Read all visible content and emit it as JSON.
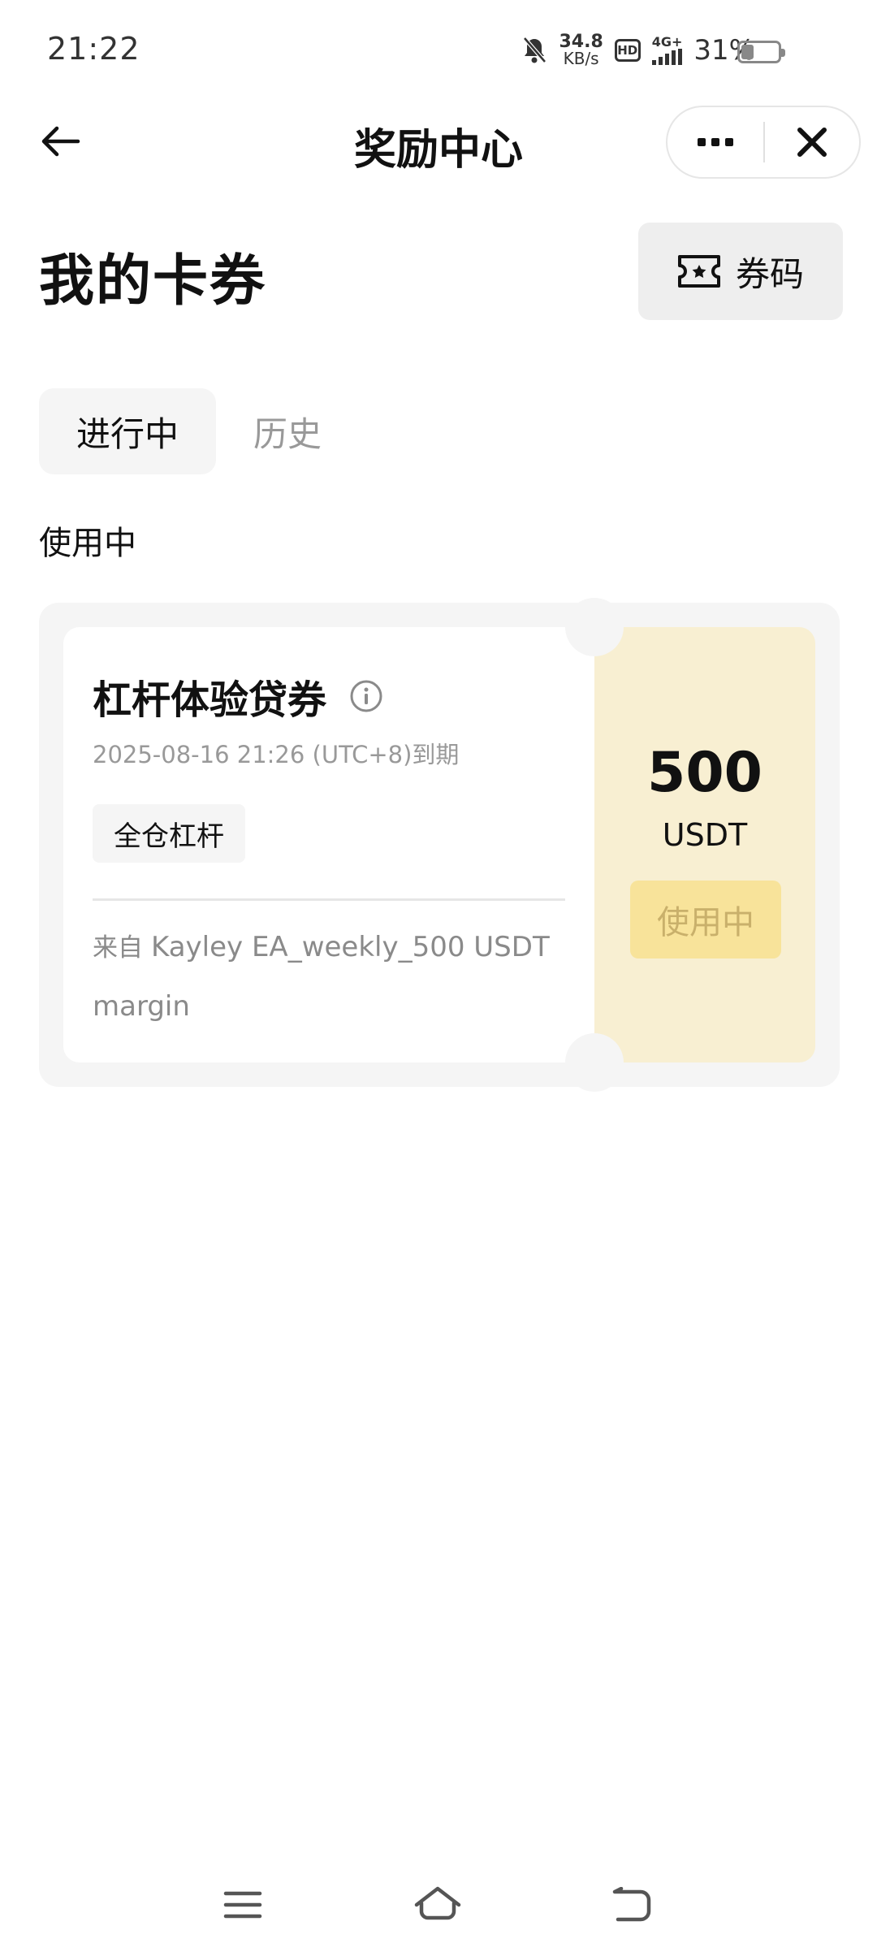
{
  "status_bar": {
    "time": "21:22",
    "net_speed_value": "34.8",
    "net_speed_unit": "KB/s",
    "hd_label": "HD",
    "network_label": "4G+",
    "battery_percent_text": "31%",
    "battery_level": 0.31
  },
  "nav": {
    "title": "奖励中心"
  },
  "header": {
    "title": "我的卡券",
    "code_button_label": "券码"
  },
  "tabs": [
    {
      "label": "进行中",
      "active": true
    },
    {
      "label": "历史",
      "active": false
    }
  ],
  "section_label": "使用中",
  "coupon": {
    "name": "杠杆体验贷券",
    "expiry": "2025-08-16 21:26 (UTC+8)到期",
    "tag": "全仓杠杆",
    "source_prefix": "来自",
    "source": "Kayley EA_weekly_500 USDT margin",
    "amount": "500",
    "unit": "USDT",
    "status": "使用中"
  },
  "colors": {
    "coupon_right_bg": "#f8efd2",
    "status_button_bg": "#f8e39a",
    "status_button_text": "#c9b06b"
  },
  "icons": {
    "back": "arrow-left-icon",
    "more": "more-dots-icon",
    "close": "close-icon",
    "ticket": "ticket-icon",
    "info": "info-icon",
    "menu": "menu-icon",
    "home": "home-icon",
    "return": "back-return-icon"
  }
}
